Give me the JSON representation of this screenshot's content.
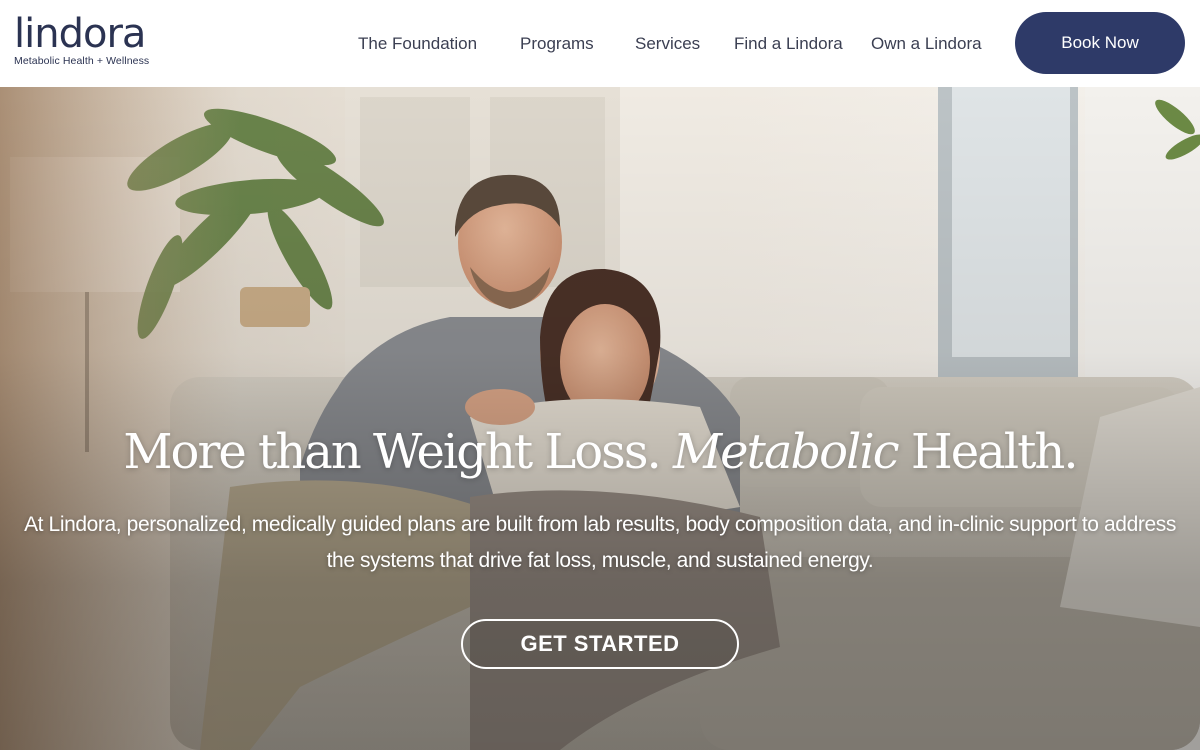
{
  "header": {
    "logo": {
      "word": "lindora",
      "tagline": "Metabolic Health + Wellness"
    },
    "nav": [
      {
        "label": "The Foundation"
      },
      {
        "label": "Programs"
      },
      {
        "label": "Services"
      },
      {
        "label": "Find a Lindora"
      },
      {
        "label": "Own a Lindora"
      }
    ],
    "cta_label": "Book Now"
  },
  "hero": {
    "title_part1": "More than Weight Loss.",
    "title_italic": "Metabolic",
    "title_part2": "Health.",
    "subtitle": "At Lindora, personalized, medically guided plans are built from lab results, body composition data, and in-clinic support to address the systems that drive fat loss, muscle, and sustained energy.",
    "button_label": "GET STARTED",
    "image_alt": "Smiling couple relaxing on a couch in a bright living room"
  },
  "colors": {
    "brand_navy": "#2e3a68",
    "logo": "#2b3352",
    "nav_text": "#3b3f52"
  }
}
